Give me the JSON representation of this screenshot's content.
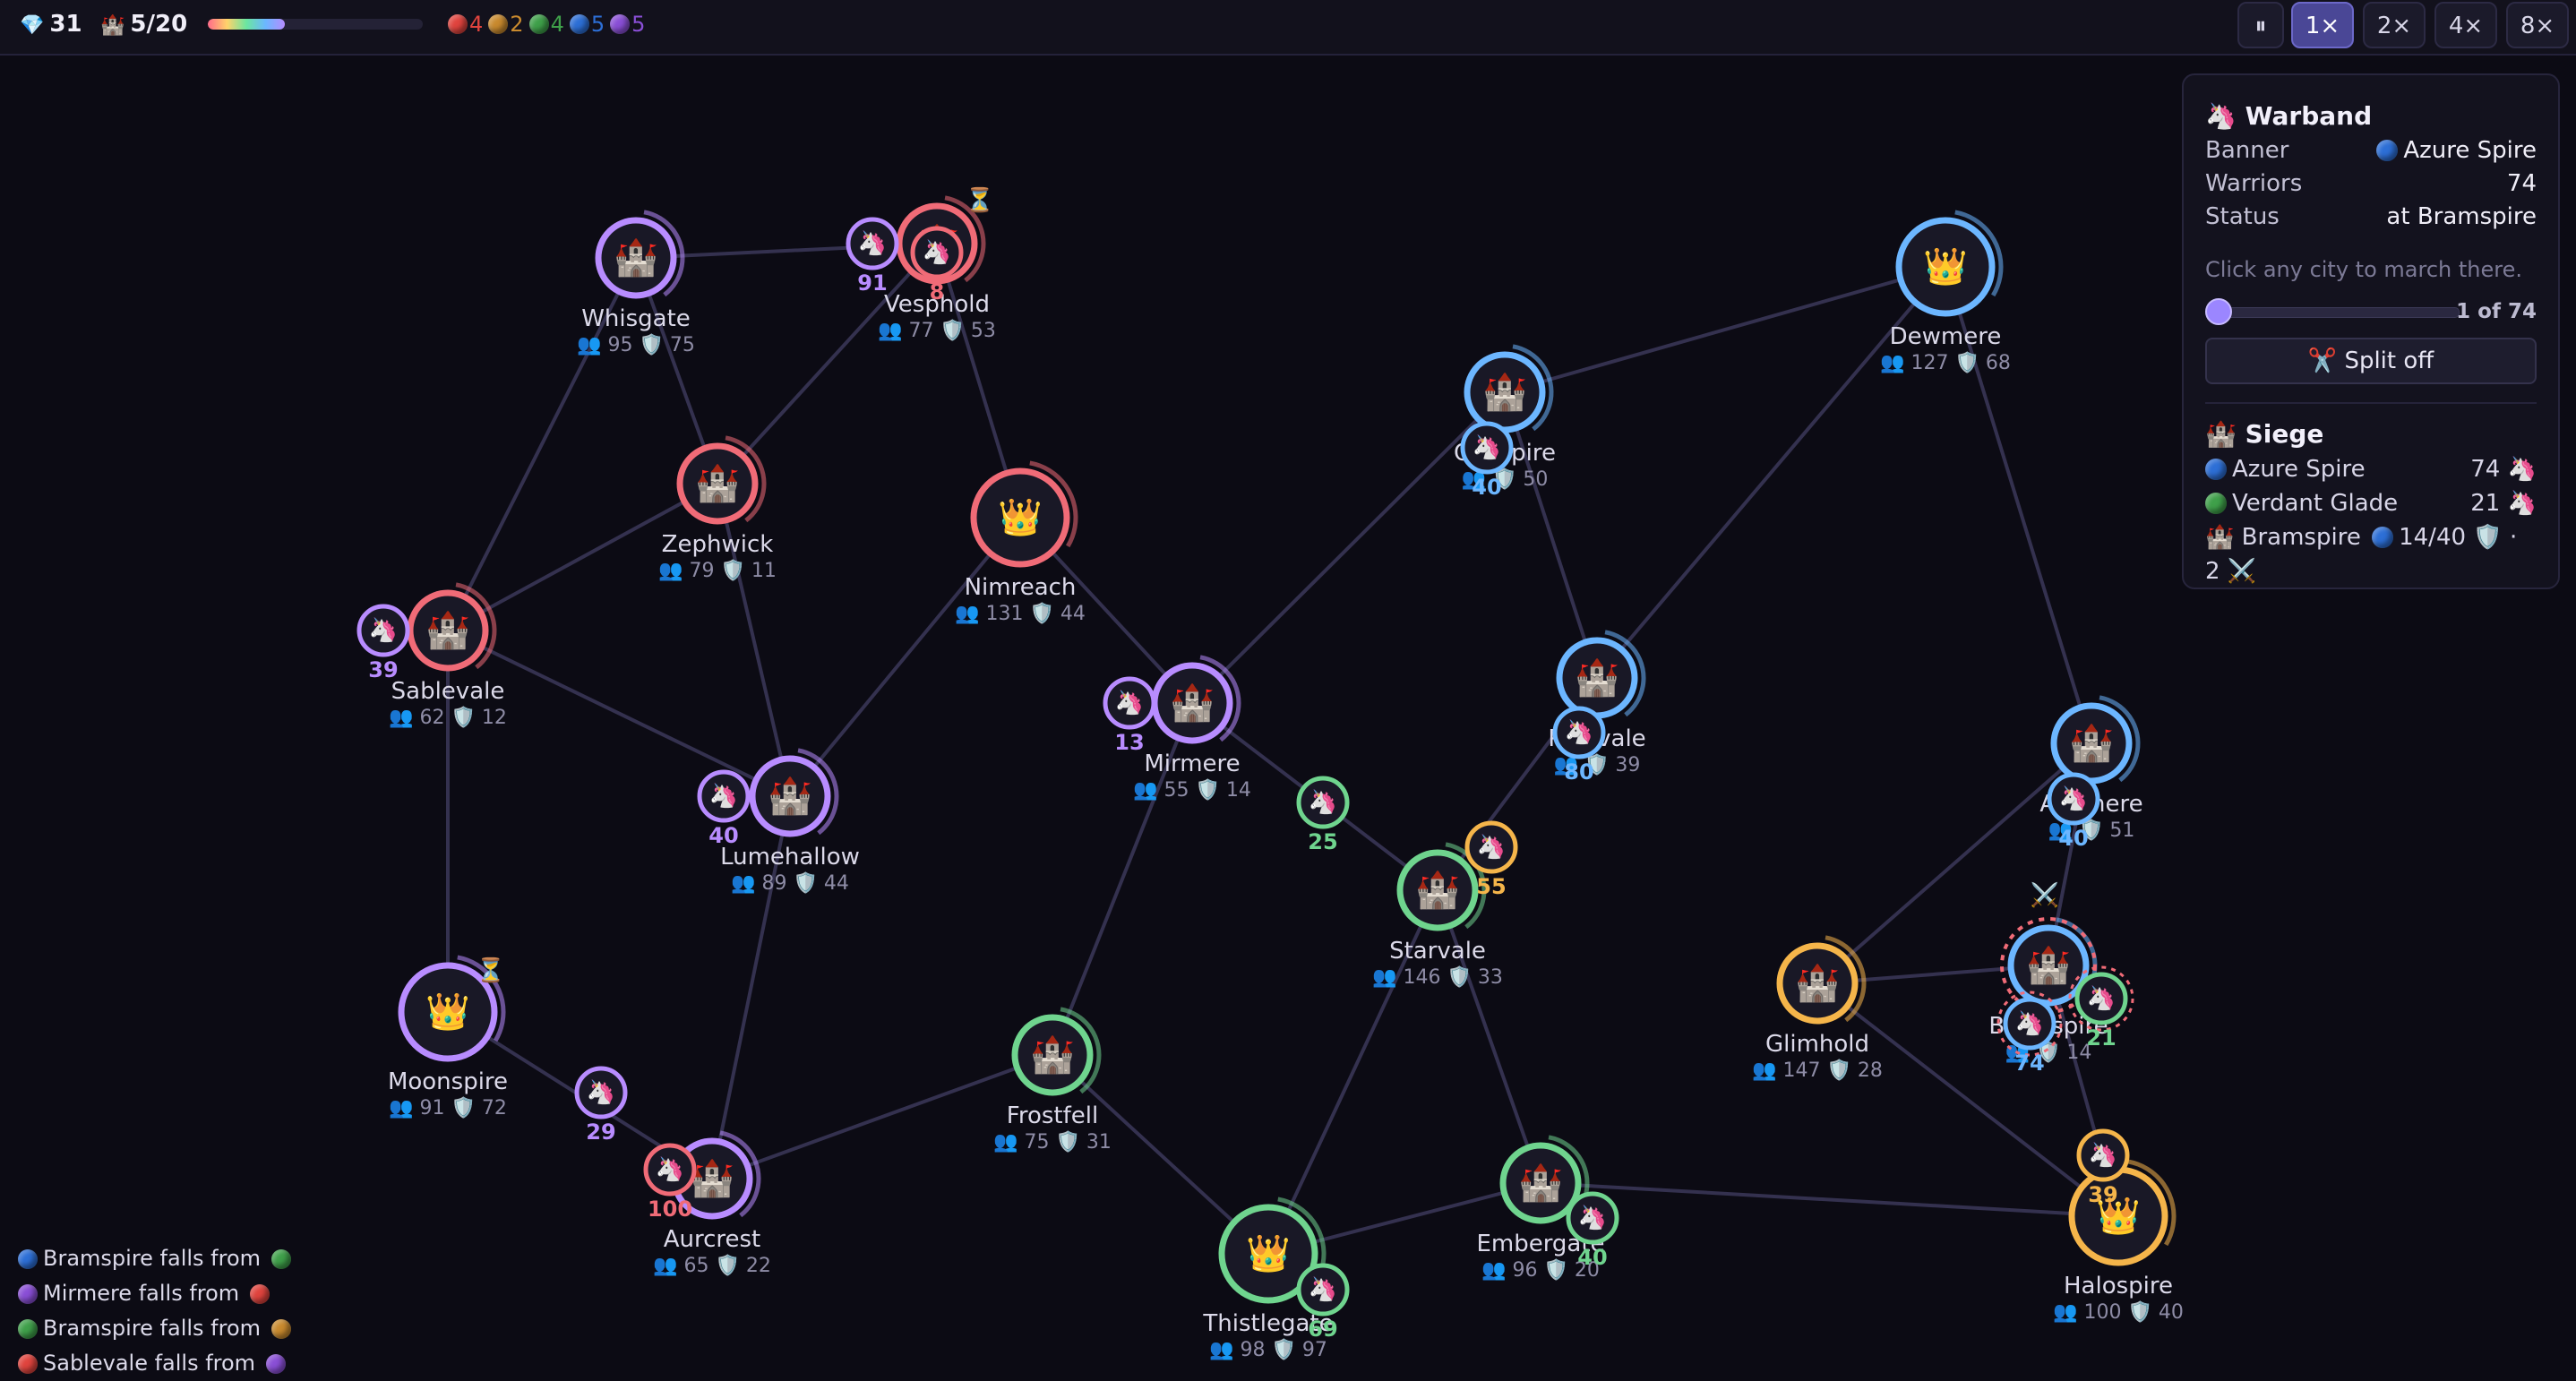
{
  "topbar": {
    "gems": "31",
    "gem_icon": "gem-icon",
    "cities": "5/20",
    "city_icon": "castle-icon",
    "progress_fraction": 0.36,
    "faction_counts": [
      {
        "color": "#e0443e",
        "count": "4"
      },
      {
        "color": "#c98a2e",
        "count": "2"
      },
      {
        "color": "#3fa04a",
        "count": "4"
      },
      {
        "color": "#2d6fd6",
        "count": "5"
      },
      {
        "color": "#8a4fd6",
        "count": "5"
      }
    ],
    "pause_icon": "pause-icon",
    "speeds": [
      "1×",
      "2×",
      "4×",
      "8×"
    ],
    "active_speed": "1×"
  },
  "colors": {
    "red": "#f06b77",
    "purple": "#b88cff",
    "green": "#6fd48e",
    "blue": "#6cb6ff",
    "orange": "#f5b54a",
    "road": "#34314f",
    "node_fill": "#191826"
  },
  "cities": [
    {
      "id": "whisgate",
      "name": "Whisgate",
      "pop": "95",
      "def": "75",
      "faction": "purple",
      "icon": "🏰",
      "capital": false
    },
    {
      "id": "vesphold",
      "name": "Vesphold",
      "pop": "77",
      "def": "53",
      "faction": "red",
      "icon": "🏰",
      "capital": false
    },
    {
      "id": "zephwick",
      "name": "Zephwick",
      "pop": "79",
      "def": "11",
      "faction": "red",
      "icon": "🏰",
      "capital": false
    },
    {
      "id": "nimreach",
      "name": "Nimreach",
      "pop": "131",
      "def": "44",
      "faction": "red",
      "icon": "👑",
      "capital": true
    },
    {
      "id": "sablevale",
      "name": "Sablevale",
      "pop": "62",
      "def": "12",
      "faction": "red",
      "icon": "🏰",
      "capital": false
    },
    {
      "id": "lumehallow",
      "name": "Lumehallow",
      "pop": "89",
      "def": "44",
      "faction": "purple",
      "icon": "🏰",
      "capital": false
    },
    {
      "id": "mirmere",
      "name": "Mirmere",
      "pop": "55",
      "def": "14",
      "faction": "purple",
      "icon": "🏰",
      "capital": false
    },
    {
      "id": "moonspire",
      "name": "Moonspire",
      "pop": "91",
      "def": "72",
      "faction": "purple",
      "icon": "👑",
      "capital": true
    },
    {
      "id": "aurcrest",
      "name": "Aurcrest",
      "pop": "65",
      "def": "22",
      "faction": "purple",
      "icon": "🏰",
      "capital": false
    },
    {
      "id": "frostfell",
      "name": "Frostfell",
      "pop": "75",
      "def": "31",
      "faction": "green",
      "icon": "🏰",
      "capital": false
    },
    {
      "id": "starvale",
      "name": "Starvale",
      "pop": "146",
      "def": "33",
      "faction": "green",
      "icon": "🏰",
      "capital": false
    },
    {
      "id": "thistlegate",
      "name": "Thistlegate",
      "pop": "98",
      "def": "97",
      "faction": "green",
      "icon": "👑",
      "capital": true
    },
    {
      "id": "embergate",
      "name": "Embergate",
      "pop": "96",
      "def": "20",
      "faction": "green",
      "icon": "🏰",
      "capital": false
    },
    {
      "id": "cobspire",
      "name": "Cobspire",
      "pop": "",
      "def": "50",
      "faction": "blue",
      "icon": "🏰",
      "capital": false
    },
    {
      "id": "pinevale",
      "name": "Pinevale",
      "pop": "",
      "def": "39",
      "faction": "blue",
      "icon": "🏰",
      "capital": false
    },
    {
      "id": "dewmere",
      "name": "Dewmere",
      "pop": "127",
      "def": "68",
      "faction": "blue",
      "icon": "👑",
      "capital": true
    },
    {
      "id": "ashmere",
      "name": "Ashmere",
      "pop": "",
      "def": "51",
      "faction": "blue",
      "icon": "🏰",
      "capital": false
    },
    {
      "id": "bramspire",
      "name": "Bramspire",
      "pop": "",
      "def": "14",
      "faction": "blue",
      "icon": "🏰",
      "capital": false
    },
    {
      "id": "glimhold",
      "name": "Glimhold",
      "pop": "147",
      "def": "28",
      "faction": "orange",
      "icon": "🏰",
      "capital": false
    },
    {
      "id": "halospire",
      "name": "Halospire",
      "pop": "100",
      "def": "40",
      "faction": "orange",
      "icon": "👑",
      "capital": true
    }
  ],
  "units": [
    {
      "id": "u-vesphold-purple",
      "count": "91",
      "faction": "purple"
    },
    {
      "id": "u-vesphold-red",
      "count": "8",
      "faction": "red"
    },
    {
      "id": "u-sablevale",
      "count": "39",
      "faction": "purple"
    },
    {
      "id": "u-lumehallow",
      "count": "40",
      "faction": "purple"
    },
    {
      "id": "u-mirmere",
      "count": "13",
      "faction": "purple"
    },
    {
      "id": "u-road-green",
      "count": "25",
      "faction": "green"
    },
    {
      "id": "u-starvale",
      "count": "55",
      "faction": "orange"
    },
    {
      "id": "u-cobspire",
      "count": "40",
      "faction": "blue"
    },
    {
      "id": "u-pinevale",
      "count": "80",
      "faction": "blue"
    },
    {
      "id": "u-ashmere",
      "count": "40",
      "faction": "blue"
    },
    {
      "id": "u-moonspire-road",
      "count": "29",
      "faction": "purple"
    },
    {
      "id": "u-aurcrest",
      "count": "100",
      "faction": "red"
    },
    {
      "id": "u-thistlegate",
      "count": "69",
      "faction": "green"
    },
    {
      "id": "u-embergate",
      "count": "40",
      "faction": "green"
    },
    {
      "id": "u-bramspire-blue",
      "count": "74",
      "faction": "blue"
    },
    {
      "id": "u-bramspire-green",
      "count": "21",
      "faction": "green"
    },
    {
      "id": "u-halospire",
      "count": "39",
      "faction": "orange"
    }
  ],
  "panel": {
    "warband_title": "Warband",
    "warband_icon": "unicorn-icon",
    "rows": [
      {
        "label": "Banner",
        "value": "Azure Spire",
        "color": "#2d6fd6"
      },
      {
        "label": "Warriors",
        "value": "74"
      },
      {
        "label": "Status",
        "value": "at Bramspire"
      }
    ],
    "hint": "Click any city to march there.",
    "slider_label": "1 of 74",
    "slider_fraction": 0.0135,
    "split_label": "Split off",
    "split_icon": "scissors-icon",
    "siege_title": "Siege",
    "siege_icon": "castle-icon",
    "siege_rows": [
      {
        "name": "Azure Spire",
        "value": "74",
        "color": "#2d6fd6"
      },
      {
        "name": "Verdant Glade",
        "value": "21",
        "color": "#3fa04a"
      }
    ],
    "siege_city": "Bramspire",
    "siege_city_stats": "14/40",
    "siege_city_extra": "· 2"
  },
  "log": [
    {
      "text": "Bramspire falls from",
      "from": "#2d6fd6",
      "to": "#3fa04a"
    },
    {
      "text": "Mirmere falls from",
      "from": "#8a4fd6",
      "to": "#e0443e"
    },
    {
      "text": "Bramspire falls from",
      "from": "#3fa04a",
      "to": "#c98a2e"
    },
    {
      "text": "Sablevale falls from",
      "from": "#e0443e",
      "to": "#8a4fd6"
    }
  ]
}
